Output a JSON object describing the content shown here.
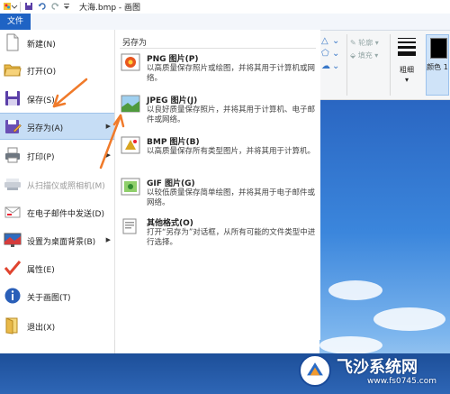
{
  "window": {
    "title": "大海.bmp - 画图"
  },
  "ribbon": {
    "file_tab": "文件",
    "outline_label": "轮廓",
    "fill_label": "填充",
    "thickness_label": "粗细",
    "color1_label": "颜色 1",
    "colors": {
      "file_tab": "#1f63c4",
      "active_row": "#c6ddf5",
      "arrow": "#f07a2a"
    }
  },
  "file_menu": {
    "items": [
      {
        "label": "新建(N)",
        "icon": "new-file-icon"
      },
      {
        "label": "打开(O)",
        "icon": "open-folder-icon"
      },
      {
        "label": "保存(S)",
        "icon": "save-disk-icon"
      },
      {
        "label": "另存为(A)",
        "icon": "save-as-icon",
        "submenu": true,
        "active": true
      },
      {
        "label": "打印(P)",
        "icon": "printer-icon",
        "submenu": true
      },
      {
        "label": "从扫描仪或照相机(M)",
        "icon": "scanner-icon",
        "disabled": true
      },
      {
        "label": "在电子邮件中发送(D)",
        "icon": "email-icon"
      },
      {
        "label": "设置为桌面背景(B)",
        "icon": "desktop-background-icon",
        "submenu": true
      },
      {
        "label": "属性(E)",
        "icon": "properties-check-icon"
      },
      {
        "label": "关于画图(T)",
        "icon": "info-icon"
      },
      {
        "label": "退出(X)",
        "icon": "exit-icon"
      }
    ]
  },
  "save_as": {
    "header": "另存为",
    "options": [
      {
        "title": "PNG 图片(P)",
        "desc": "以高质量保存照片或绘图，并将其用于计算机或网络。",
        "icon": "png-image-icon"
      },
      {
        "title": "JPEG 图片(J)",
        "desc": "以良好质量保存照片，并将其用于计算机、电子邮件或网络。",
        "icon": "jpeg-image-icon"
      },
      {
        "title": "BMP 图片(B)",
        "desc": "以高质量保存所有类型图片，并将其用于计算机。",
        "icon": "bmp-image-icon"
      },
      {
        "title": "GIF 图片(G)",
        "desc": "以较低质量保存简单绘图，并将其用于电子邮件或网络。",
        "icon": "gif-image-icon"
      },
      {
        "title": "其他格式(O)",
        "desc": "打开“另存为”对话框，从所有可能的文件类型中进行选择。",
        "icon": "other-formats-icon"
      }
    ]
  },
  "watermark": {
    "name": "飞沙系统网",
    "url": "www.fs0745.com"
  }
}
